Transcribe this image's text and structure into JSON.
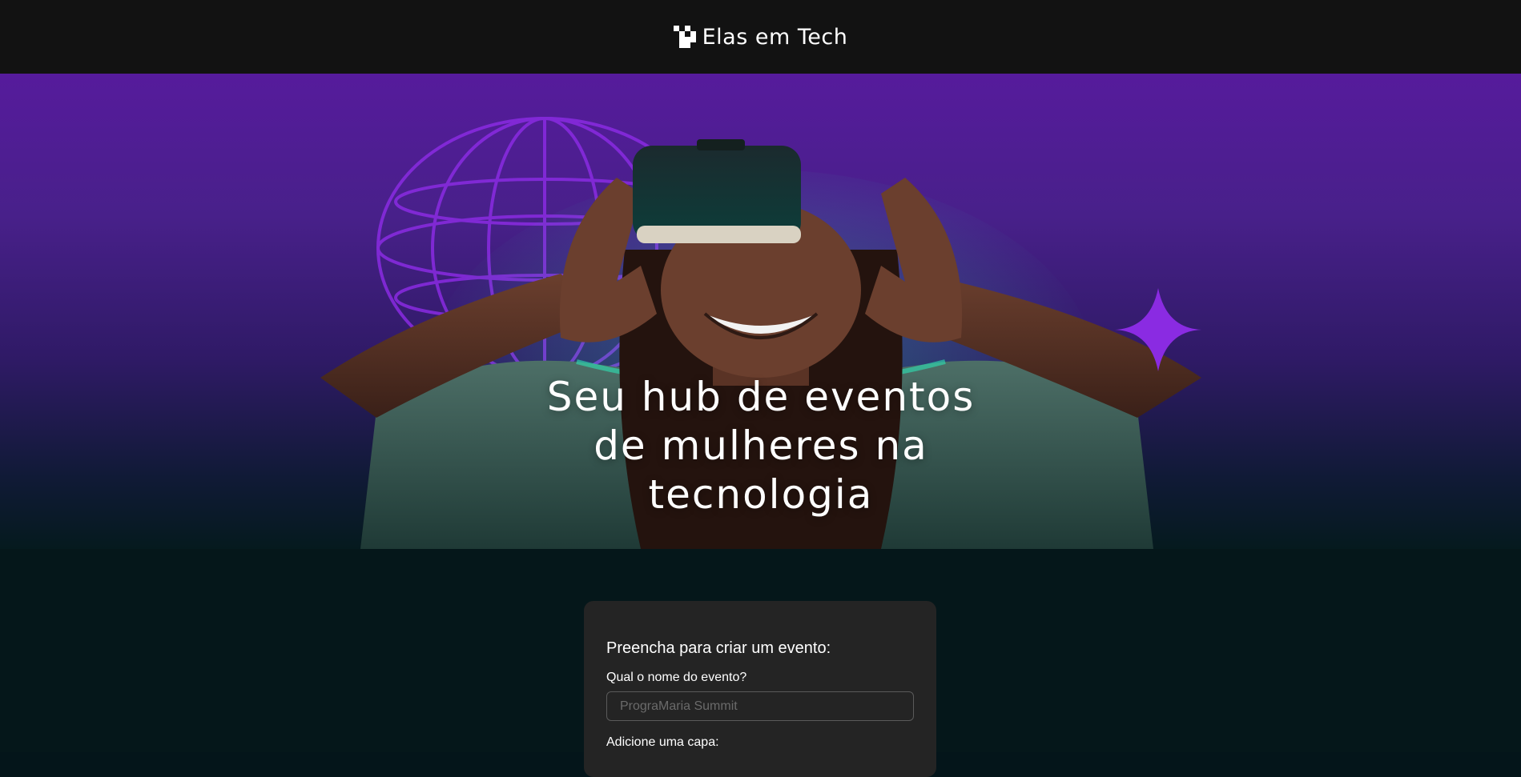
{
  "header": {
    "brand_name": "Elas em Tech",
    "logo_icon": "pixel-grid-logo"
  },
  "hero": {
    "title_lines": [
      "Seu hub de eventos",
      "de mulheres na",
      "tecnologia"
    ],
    "image_description_icons": [
      "globe-wireframe-icon",
      "sparkle-star-icon"
    ],
    "colors": {
      "top": "#561b9c",
      "bottom": "#051a1e",
      "accent": "#8a2be2"
    }
  },
  "form": {
    "heading": "Preencha para criar um evento:",
    "event_name_label": "Qual o nome do evento?",
    "event_name_placeholder": "PrograMaria Summit",
    "event_name_value": "",
    "cover_label": "Adicione uma capa:"
  }
}
